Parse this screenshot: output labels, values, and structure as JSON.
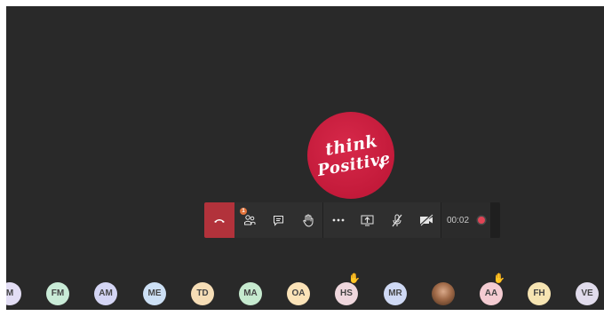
{
  "call": {
    "timer": "00:02",
    "center_logo": {
      "line1": "think",
      "line2": "Positive",
      "heart": "♥"
    },
    "badge_count": "1"
  },
  "controls": [
    {
      "name": "hang-up",
      "icon": "phone-hangup-icon"
    },
    {
      "name": "participants",
      "icon": "people-icon"
    },
    {
      "name": "chat",
      "icon": "chat-icon"
    },
    {
      "name": "raise-hand",
      "icon": "hand-icon"
    },
    {
      "name": "more",
      "icon": "more-icon"
    },
    {
      "name": "share",
      "icon": "share-screen-icon"
    },
    {
      "name": "mute",
      "icon": "mic-off-icon"
    },
    {
      "name": "camera",
      "icon": "camera-off-icon"
    }
  ],
  "participants": [
    {
      "initials": "M",
      "color": "#e3def5"
    },
    {
      "initials": "FM",
      "color": "#c9ebd7"
    },
    {
      "initials": "AM",
      "color": "#d4d5f4"
    },
    {
      "initials": "ME",
      "color": "#cde0f5"
    },
    {
      "initials": "TD",
      "color": "#f6ddb6"
    },
    {
      "initials": "MA",
      "color": "#c6eacf"
    },
    {
      "initials": "OA",
      "color": "#fbe3b8"
    },
    {
      "initials": "HS",
      "color": "#efd7dd",
      "hand": "✋"
    },
    {
      "initials": "MR",
      "color": "#cfd9f4"
    },
    {
      "initials": "",
      "color": "#8a5a3a",
      "photo": true
    },
    {
      "initials": "AA",
      "color": "#f4ccd2",
      "hand": "✋"
    },
    {
      "initials": "FH",
      "color": "#f6e4b2"
    },
    {
      "initials": "VE",
      "color": "#e1dcec"
    }
  ],
  "colors": {
    "stage": "#292929",
    "hangup": "#b2323b",
    "logo_red": "#c31a3a",
    "record": "#e04455"
  }
}
